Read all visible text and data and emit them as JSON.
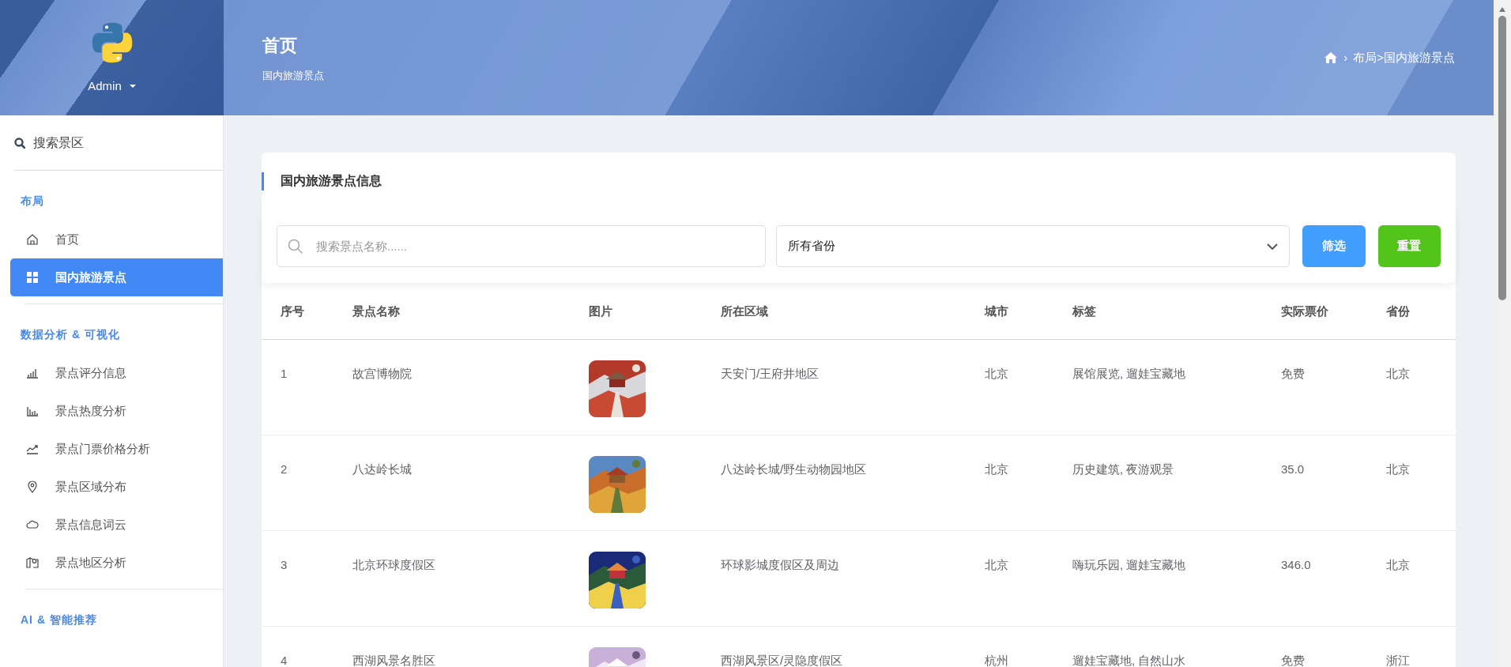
{
  "sidebar": {
    "user": {
      "name": "Admin"
    },
    "search": {
      "placeholder": "搜索景区"
    },
    "sections": [
      {
        "title": "布局",
        "items": [
          {
            "label": "首页",
            "selected": false
          },
          {
            "label": "国内旅游景点",
            "selected": true
          }
        ]
      },
      {
        "title": "数据分析 & 可视化",
        "items": [
          {
            "label": "景点评分信息",
            "selected": false
          },
          {
            "label": "景点热度分析",
            "selected": false
          },
          {
            "label": "景点门票价格分析",
            "selected": false
          },
          {
            "label": "景点区域分布",
            "selected": false
          },
          {
            "label": "景点信息词云",
            "selected": false
          },
          {
            "label": "景点地区分析",
            "selected": false
          }
        ]
      },
      {
        "title": "AI & 智能推荐"
      }
    ]
  },
  "header": {
    "title": "首页",
    "subtitle": "国内旅游景点",
    "breadcrumb": {
      "separator": "›",
      "path": "布局>国内旅游景点"
    }
  },
  "card": {
    "title": "国内旅游景点信息",
    "filters": {
      "search": {
        "placeholder": "搜索景点名称......"
      },
      "province": {
        "value": "所有省份"
      },
      "buttons": [
        {
          "label": "筛选",
          "kind": "primary"
        },
        {
          "label": "重置",
          "kind": "reset"
        }
      ]
    },
    "table": {
      "columns": [
        "序号",
        "景点名称",
        "图片",
        "所在区域",
        "城市",
        "标签",
        "实际票价",
        "省份"
      ],
      "rows": [
        [
          "1",
          "故宫博物院",
          "",
          "天安门/王府井地区",
          "北京",
          "展馆展览, 遛娃宝藏地",
          "免费",
          "北京"
        ],
        [
          "2",
          "八达岭长城",
          "",
          "八达岭长城/野生动物园地区",
          "北京",
          "历史建筑, 夜游观景",
          "35.0",
          "北京"
        ],
        [
          "3",
          "北京环球度假区",
          "",
          "环球影城度假区及周边",
          "北京",
          "嗨玩乐园, 遛娃宝藏地",
          "346.0",
          "北京"
        ],
        [
          "4",
          "西湖风景名胜区",
          "",
          "西湖风景区/灵隐度假区",
          "杭州",
          "遛娃宝藏地, 自然山水",
          "免费",
          "浙江"
        ]
      ]
    }
  }
}
